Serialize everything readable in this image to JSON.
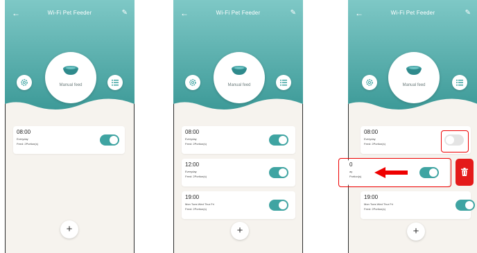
{
  "colors": {
    "accent": "#3fa4a2",
    "highlight": "#e00000",
    "delete": "#e41a1a"
  },
  "screens": [
    {
      "header": {
        "title": "Wi-Fi Pet Feeder",
        "back_icon": "arrow-left-icon",
        "edit_icon": "pencil-icon"
      },
      "manual_feed_label": "Manual feed",
      "schedules": [
        {
          "time": "08:00",
          "repeat": "Everyday",
          "portion": "Feed: 2Portion(s)",
          "enabled": true
        }
      ]
    },
    {
      "header": {
        "title": "Wi-Fi Pet Feeder",
        "back_icon": "arrow-left-icon",
        "edit_icon": "pencil-icon"
      },
      "manual_feed_label": "Manual feed",
      "schedules": [
        {
          "time": "08:00",
          "repeat": "Everyday",
          "portion": "Feed: 2Portion(s)",
          "enabled": true
        },
        {
          "time": "12:00",
          "repeat": "Everyday",
          "portion": "Feed: 2Portion(s)",
          "enabled": true
        },
        {
          "time": "19:00",
          "repeat": "Mon Tues Wed Thur Fri",
          "portion": "Feed: 2Portion(s)",
          "enabled": true
        }
      ]
    },
    {
      "header": {
        "title": "Wi-Fi Pet Feeder",
        "back_icon": "arrow-left-icon",
        "edit_icon": "pencil-icon"
      },
      "manual_feed_label": "Manual feed",
      "schedules": [
        {
          "time": "08:00",
          "repeat": "Everyday",
          "portion": "Feed: 2Portion(s)",
          "enabled": false
        },
        {
          "time": "0",
          "repeat": "ay",
          "portion": "Portion(s)",
          "enabled": true
        },
        {
          "time": "19:00",
          "repeat": "Mon Tues Wed Thur Fri",
          "portion": "Feed: 2Portion(s)",
          "enabled": true
        }
      ]
    }
  ]
}
